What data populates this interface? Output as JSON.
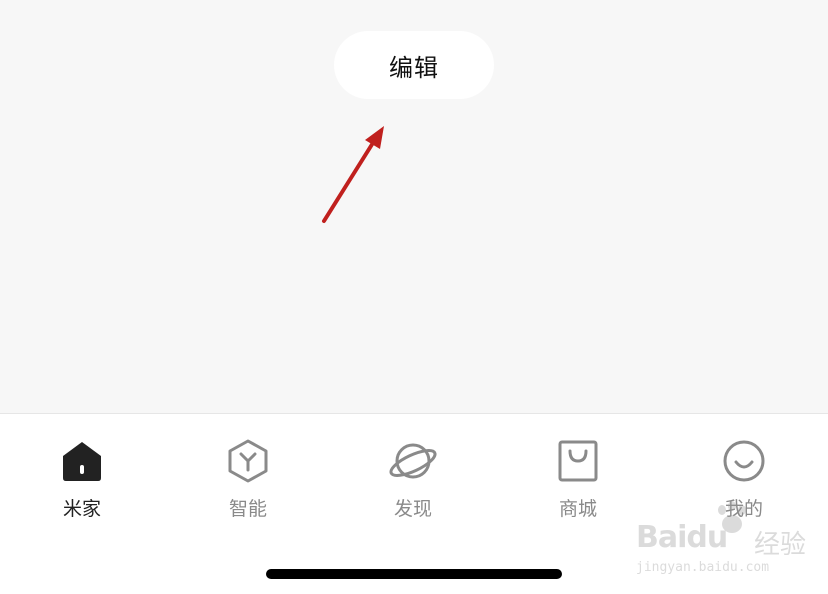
{
  "edit_button": {
    "label": "编辑"
  },
  "annotation": {
    "color": "#c0201e"
  },
  "tabs": [
    {
      "label": "米家",
      "icon": "home-icon",
      "active": true
    },
    {
      "label": "智能",
      "icon": "cube-icon",
      "active": false
    },
    {
      "label": "发现",
      "icon": "planet-icon",
      "active": false
    },
    {
      "label": "商城",
      "icon": "shopping-bag-icon",
      "active": false
    },
    {
      "label": "我的",
      "icon": "smile-icon",
      "active": false
    }
  ],
  "colors": {
    "active": "#222222",
    "inactive": "#8a8a8a",
    "background": "#f7f7f7"
  },
  "watermark": {
    "logo": "Baidu",
    "text": "经验",
    "url": "jingyan.baidu.com"
  }
}
